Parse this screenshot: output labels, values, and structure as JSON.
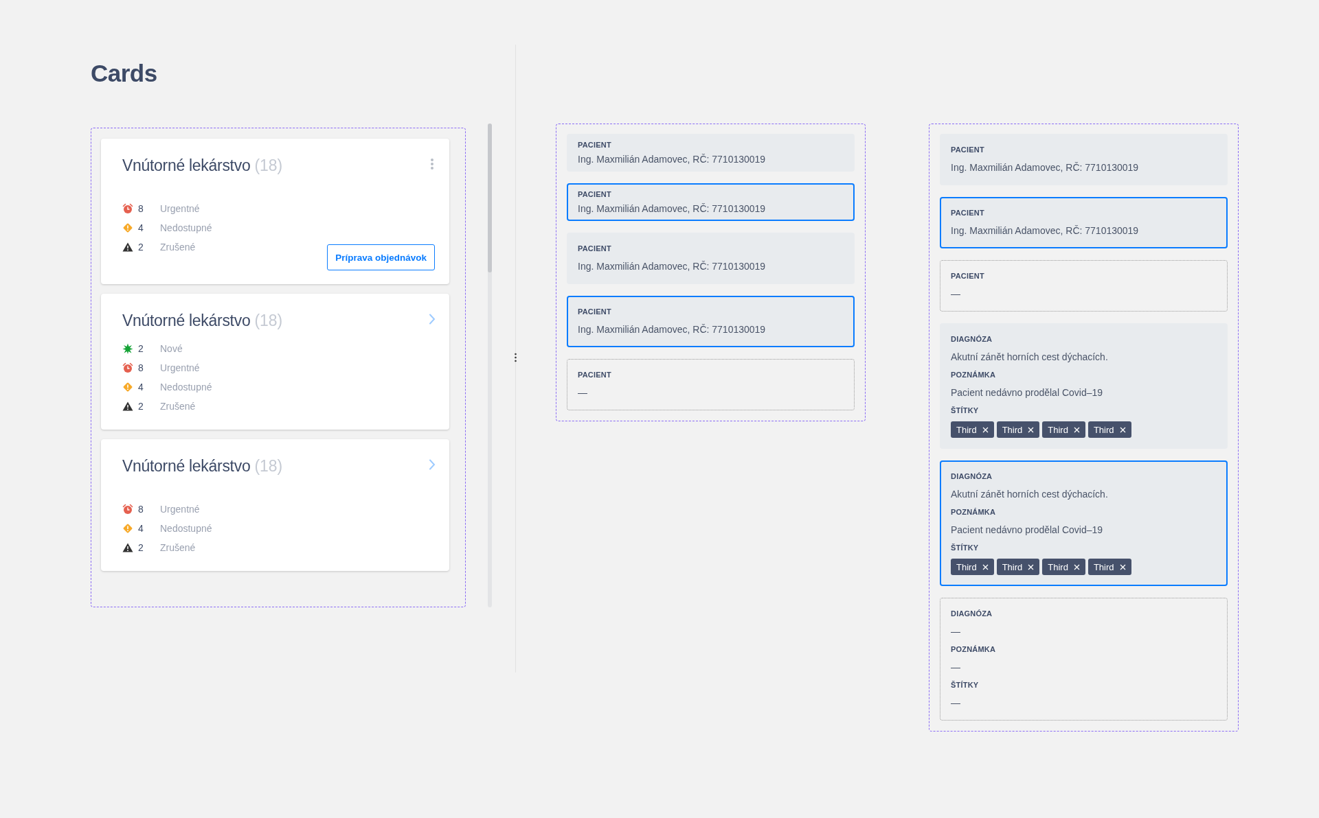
{
  "page_title": "Cards",
  "cards": [
    {
      "title": "Vnútorné lekárstvo",
      "count": "(18)",
      "kind": "menu",
      "stats": [
        {
          "kind": "urgent",
          "count": "8",
          "label": "Urgentné"
        },
        {
          "kind": "unavailable",
          "count": "4",
          "label": "Nedostupné"
        },
        {
          "kind": "cancelled",
          "count": "2",
          "label": "Zrušené"
        }
      ],
      "button": "Príprava objednávok"
    },
    {
      "title": "Vnútorné lekárstvo",
      "count": "(18)",
      "kind": "chevron",
      "stats": [
        {
          "kind": "new",
          "count": "2",
          "label": "Nové"
        },
        {
          "kind": "urgent",
          "count": "8",
          "label": "Urgentné"
        },
        {
          "kind": "unavailable",
          "count": "4",
          "label": "Nedostupné"
        },
        {
          "kind": "cancelled",
          "count": "2",
          "label": "Zrušené"
        }
      ]
    },
    {
      "title": "Vnútorné lekárstvo",
      "count": "(18)",
      "kind": "chevron",
      "stats": [
        {
          "kind": "urgent",
          "count": "8",
          "label": "Urgentné"
        },
        {
          "kind": "unavailable",
          "count": "4",
          "label": "Nedostupné"
        },
        {
          "kind": "cancelled",
          "count": "2",
          "label": "Zrušené"
        }
      ]
    }
  ],
  "column_1": {
    "items": [
      {
        "kind": "compact",
        "selected": false,
        "empty": false,
        "fields": [
          {
            "label": "PACIENT",
            "value": "Ing. Maxmilián Adamovec, RČ: 7710130019"
          }
        ]
      },
      {
        "kind": "compact",
        "selected": true,
        "empty": false,
        "fields": [
          {
            "label": "PACIENT",
            "value": "Ing. Maxmilián Adamovec, RČ: 7710130019"
          }
        ]
      },
      {
        "kind": "regular",
        "selected": false,
        "empty": false,
        "fields": [
          {
            "label": "PACIENT",
            "value": "Ing. Maxmilián Adamovec, RČ: 7710130019"
          }
        ]
      },
      {
        "kind": "regular",
        "selected": true,
        "empty": false,
        "fields": [
          {
            "label": "PACIENT",
            "value": "Ing. Maxmilián Adamovec, RČ: 7710130019"
          }
        ]
      },
      {
        "kind": "regular",
        "selected": false,
        "empty": true,
        "fields": [
          {
            "label": "PACIENT",
            "value": "—"
          }
        ]
      }
    ]
  },
  "column_2": {
    "items": [
      {
        "kind": "regular",
        "selected": false,
        "empty": false,
        "fields": [
          {
            "label": "PACIENT",
            "value": "Ing. Maxmilián Adamovec, RČ: 7710130019"
          }
        ]
      },
      {
        "kind": "regular",
        "selected": true,
        "empty": false,
        "fields": [
          {
            "label": "PACIENT",
            "value": "Ing. Maxmilián Adamovec, RČ: 7710130019"
          }
        ]
      },
      {
        "kind": "regular",
        "selected": false,
        "empty": true,
        "fields": [
          {
            "label": "PACIENT",
            "value": "—"
          }
        ]
      },
      {
        "kind": "regular",
        "selected": false,
        "empty": false,
        "fields": [
          {
            "label": "DIAGNÓZA",
            "value": "Akutní zánět horních cest dýchacích."
          },
          {
            "label": "POZNÁMKA",
            "value": "Pacient nedávno prodělal Covid–19"
          },
          {
            "label": "ŠTÍTKY",
            "tags": [
              "Third",
              "Third",
              "Third",
              "Third"
            ]
          }
        ]
      },
      {
        "kind": "regular",
        "selected": true,
        "empty": false,
        "fields": [
          {
            "label": "DIAGNÓZA",
            "value": "Akutní zánět horních cest dýchacích."
          },
          {
            "label": "POZNÁMKA",
            "value": "Pacient nedávno prodělal Covid–19"
          },
          {
            "label": "ŠTÍTKY",
            "tags": [
              "Third",
              "Third",
              "Third",
              "Third"
            ]
          }
        ]
      },
      {
        "kind": "regular",
        "selected": false,
        "empty": true,
        "fields": [
          {
            "label": "DIAGNÓZA",
            "value": "—"
          },
          {
            "label": "POZNÁMKA",
            "value": "—"
          },
          {
            "label": "ŠTÍTKY",
            "value": "—"
          }
        ]
      }
    ]
  }
}
